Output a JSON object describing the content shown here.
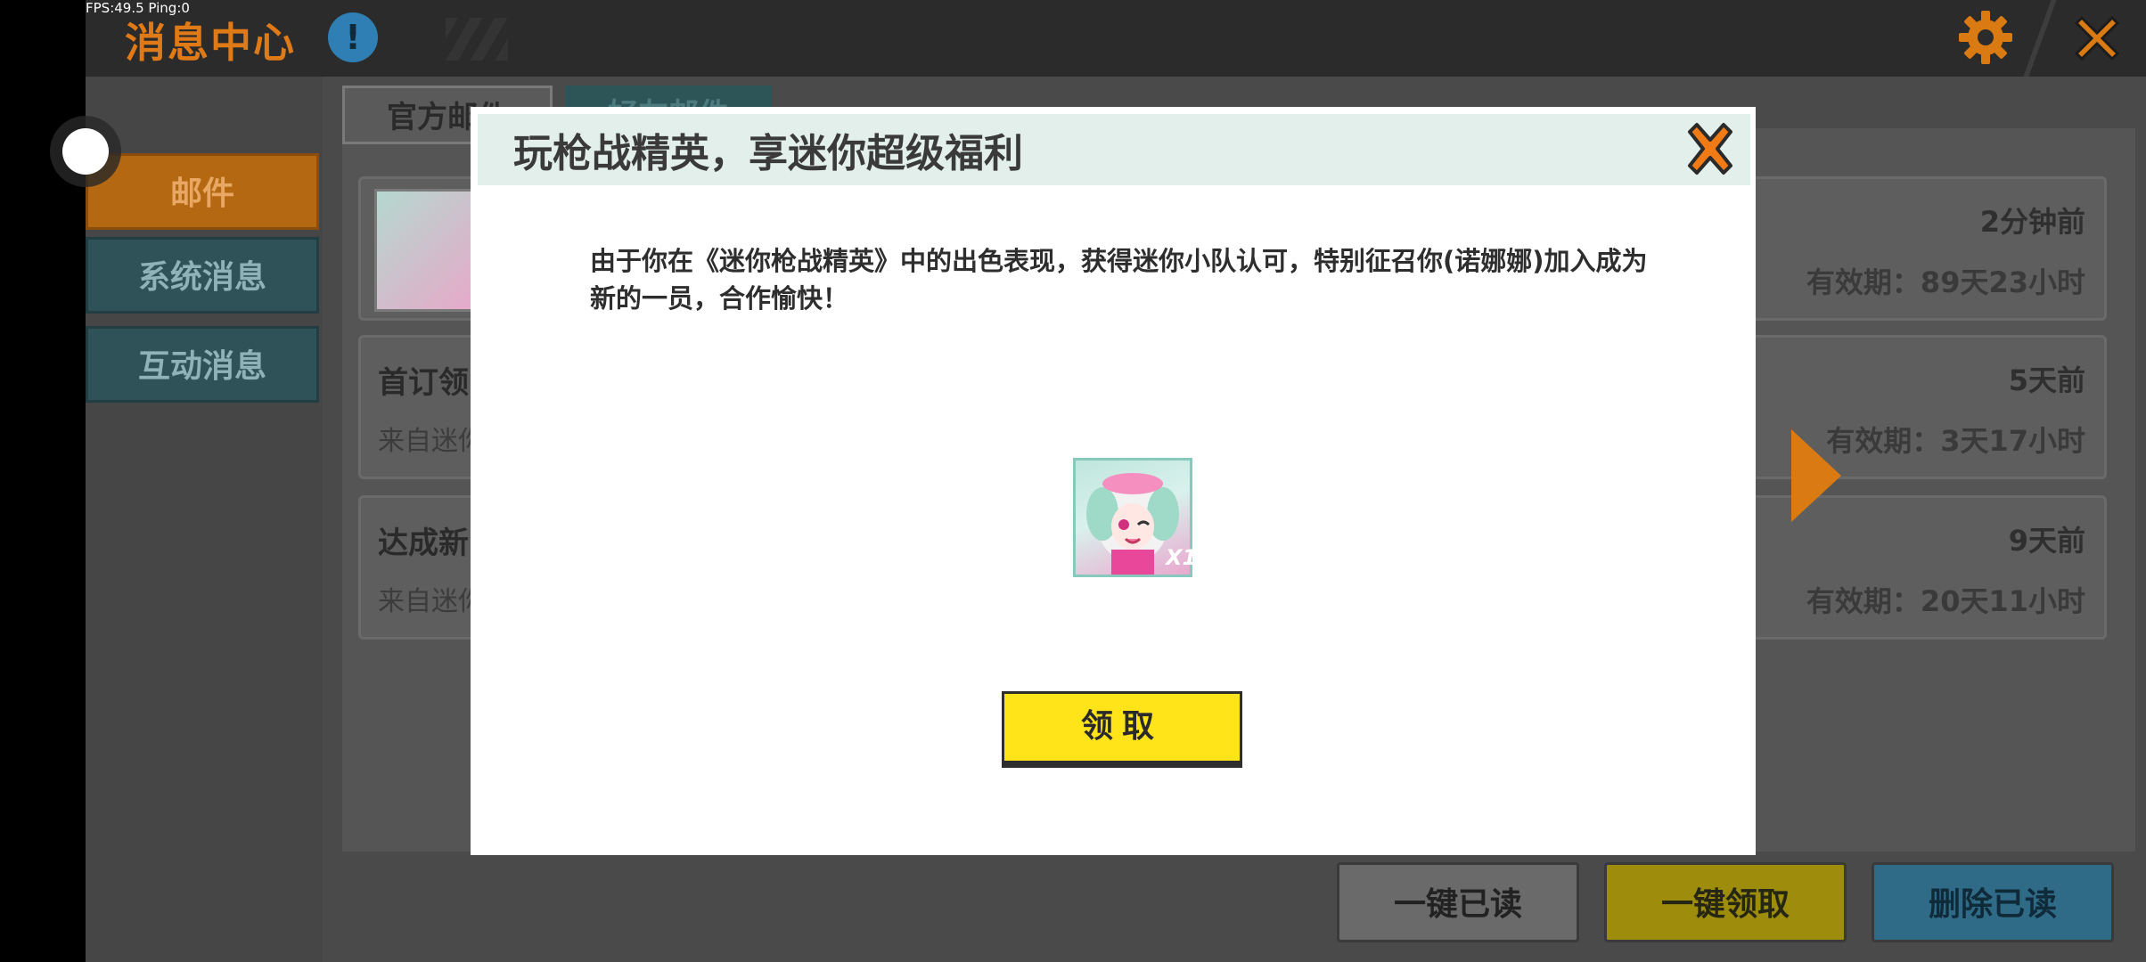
{
  "status": {
    "fps_text": "FPS:49.5  Ping:0"
  },
  "header": {
    "title": "消息中心",
    "info_icon": "!",
    "settings_icon": "gear-icon",
    "close_icon": "close-icon"
  },
  "sidebar": {
    "items": [
      {
        "label": "邮件",
        "selected": true
      },
      {
        "label": "系统消息",
        "selected": false
      },
      {
        "label": "互动消息",
        "selected": false
      }
    ]
  },
  "tabs": [
    {
      "label": "官方邮件",
      "selected": true
    },
    {
      "label": "好友邮件",
      "selected": false
    }
  ],
  "mail_list": [
    {
      "title": "",
      "from": "",
      "time": "2分钟前",
      "expiry": "有效期：89天23小时"
    },
    {
      "title": "首订领",
      "from": "来自迷你",
      "time": "5天前",
      "expiry": "有效期：3天17小时"
    },
    {
      "title": "达成新",
      "from": "来自迷你",
      "time": "9天前",
      "expiry": "有效期：20天11小时"
    }
  ],
  "bottom_buttons": {
    "read_all": "一键已读",
    "claim_all": "一键领取",
    "delete_read": "删除已读"
  },
  "modal": {
    "title": "玩枪战精英，享迷你超级福利",
    "body": "由于你在《迷你枪战精英》中的出色表现，获得迷你小队认可，特别征召你(诺娜娜)加入成为新的一员，合作愉快！",
    "reward": {
      "count": "X1"
    },
    "claim_label": "领取"
  },
  "colors": {
    "accent_orange": "#e07a17",
    "claim_yellow": "#ffe41a",
    "teal": "#2e5257"
  }
}
